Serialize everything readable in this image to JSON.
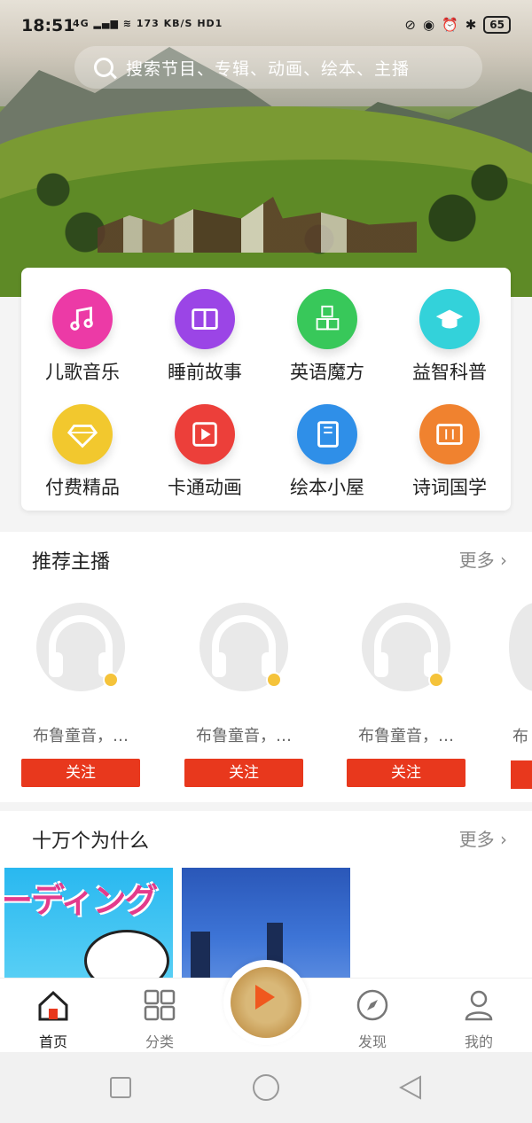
{
  "status_bar": {
    "time": "18:51",
    "network": "4G",
    "speed": "173 KB/S",
    "hd": "HD1",
    "battery": "65"
  },
  "search": {
    "placeholder": "搜索节目、专辑、动画、绘本、主播"
  },
  "categories": [
    {
      "label": "儿歌音乐",
      "icon": "music-note-icon",
      "color": "#ec3aa6"
    },
    {
      "label": "睡前故事",
      "icon": "book-icon",
      "color": "#9b45e6"
    },
    {
      "label": "英语魔方",
      "icon": "abc-blocks-icon",
      "color": "#38c85a"
    },
    {
      "label": "益智科普",
      "icon": "graduation-cap-icon",
      "color": "#33d2da"
    },
    {
      "label": "付费精品",
      "icon": "diamond-icon",
      "color": "#f2c82e"
    },
    {
      "label": "卡通动画",
      "icon": "film-play-icon",
      "color": "#ec3f3a"
    },
    {
      "label": "绘本小屋",
      "icon": "notebook-icon",
      "color": "#2f8fe8"
    },
    {
      "label": "诗词国学",
      "icon": "scroll-icon",
      "color": "#f0822f"
    }
  ],
  "recommended_hosts": {
    "title": "推荐主播",
    "more": "更多",
    "hosts": [
      {
        "name": "布鲁童音，…",
        "follow": "关注"
      },
      {
        "name": "布鲁童音，…",
        "follow": "关注"
      },
      {
        "name": "布鲁童音，…",
        "follow": "关注"
      },
      {
        "name": "布",
        "follow": ""
      }
    ]
  },
  "why_section": {
    "title": "十万个为什么",
    "more": "更多",
    "thumb1_text": "ーディング"
  },
  "bottom_nav": [
    {
      "label": "首页",
      "icon": "home-icon"
    },
    {
      "label": "分类",
      "icon": "grid-icon"
    },
    {
      "label": "发现",
      "icon": "compass-icon"
    },
    {
      "label": "我的",
      "icon": "user-icon"
    }
  ],
  "colors": {
    "accent_red": "#e8381d",
    "verified_gold": "#f5c33a"
  }
}
